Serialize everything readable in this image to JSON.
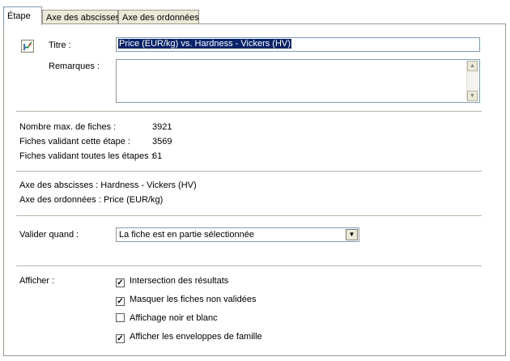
{
  "tabs": [
    "Étape",
    "Axe des abscisses",
    "Axe des ordonnées"
  ],
  "active_tab": "Étape",
  "form": {
    "title_label": "Titre :",
    "title_value": "Price (EUR/kg) vs. Hardness - Vickers (HV)",
    "remarks_label": "Remarques :",
    "remarks_value": ""
  },
  "stats": [
    {
      "label": "Nombre max. de fiches :",
      "value": "3921"
    },
    {
      "label": "Fiches validant cette étape :",
      "value": "3569"
    },
    {
      "label": "Fiches validant toutes les étapes :",
      "value": "61"
    }
  ],
  "axes": {
    "x": "Axe des abscisses : Hardness - Vickers (HV)",
    "y": "Axe des ordonnées : Price (EUR/kg)"
  },
  "validate": {
    "label": "Valider quand :",
    "selected": "La fiche est en partie sélectionnée"
  },
  "display": {
    "label": "Afficher :",
    "options": [
      {
        "label": "Intersection des résultats",
        "checked": true
      },
      {
        "label": "Masquer les fiches non validées",
        "checked": true
      },
      {
        "label": "Affichage noir et blanc",
        "checked": false
      },
      {
        "label": "Afficher les enveloppes de famille",
        "checked": true
      }
    ]
  },
  "icons": {
    "chart": "chart-icon",
    "dropdown": "chevron-down-icon",
    "scroll_up": "arrow-up-icon",
    "scroll_down": "arrow-down-icon"
  }
}
